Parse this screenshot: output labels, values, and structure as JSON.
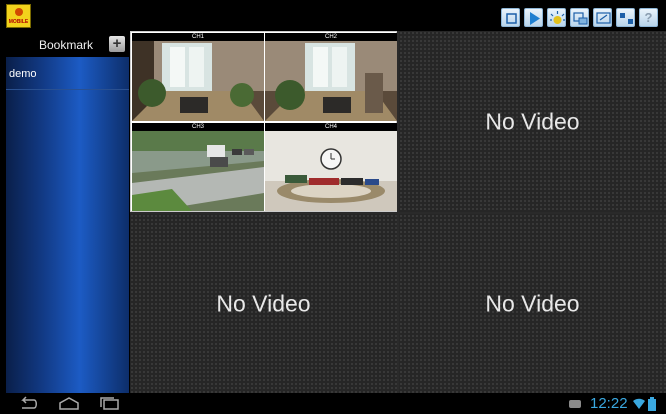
{
  "app": {
    "logo_text": "MOBILE"
  },
  "toolbar": {
    "buttons": [
      {
        "icon": "stop-icon"
      },
      {
        "icon": "play-icon"
      },
      {
        "icon": "alarm-icon"
      },
      {
        "icon": "camera-switch-icon"
      },
      {
        "icon": "layout-icon"
      },
      {
        "icon": "ptz-icon"
      },
      {
        "icon": "help-icon",
        "label": "?"
      }
    ]
  },
  "sidebar": {
    "title": "Bookmark",
    "add_label": "+",
    "items": [
      {
        "label": "demo"
      }
    ]
  },
  "grid": {
    "quad_channels": [
      {
        "label": "CH1"
      },
      {
        "label": "CH2"
      },
      {
        "label": "CH3"
      },
      {
        "label": "CH4"
      }
    ],
    "empty_text": "No Video"
  },
  "system": {
    "time": "12:22"
  },
  "colors": {
    "accent": "#3aa8e0",
    "sidebar_blue": "#1c5bc4",
    "logo_yellow": "#f2d21c"
  }
}
